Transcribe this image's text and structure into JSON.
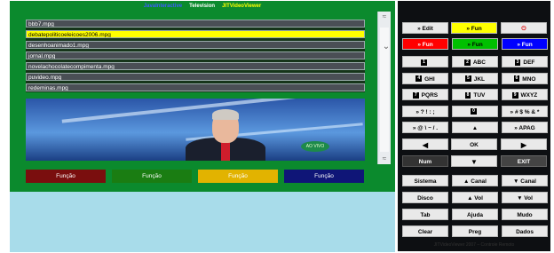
{
  "title_bar": {
    "part1": "JavaInteractive",
    "part2": "Television",
    "part3": "JITVideoViewer",
    "colors": {
      "part1": "#3e5cff",
      "part2": "#ffffff",
      "part3": "#ffff00"
    }
  },
  "playlist": {
    "items": [
      "bbb7.mpg",
      "debatepoliticoeleicoes2006.mpg",
      "desenhoanimado1.mpg",
      "jornal.mpg",
      "novelachocolatecompimenta.mpg",
      "puvideo.mpg",
      "redeminas.mpg"
    ],
    "selected_index": 1
  },
  "video": {
    "overlay_text": "AO VIVO"
  },
  "function_buttons": [
    {
      "label": "Função",
      "color": "#7a0e0e"
    },
    {
      "label": "Função",
      "color": "#1a7d12"
    },
    {
      "label": "Função",
      "color": "#e2b300"
    },
    {
      "label": "Função",
      "color": "#0f1577"
    }
  ],
  "remote": {
    "top": {
      "edit": "» Edit",
      "fun_yellow": "» Fun",
      "power": "⏻"
    },
    "color_keys": [
      {
        "label": "» Fun",
        "color": "#ff0000"
      },
      {
        "label": "» Fun",
        "color": "#00c000"
      },
      {
        "label": "» Fun",
        "color": "#0000ff"
      }
    ],
    "numpad": [
      {
        "num": "1",
        "text": ""
      },
      {
        "num": "2",
        "text": "ABC"
      },
      {
        "num": "3",
        "text": "DEF"
      },
      {
        "num": "4",
        "text": "GHI"
      },
      {
        "num": "5",
        "text": "JKL"
      },
      {
        "num": "6",
        "text": "MNO"
      },
      {
        "num": "7",
        "text": "PQRS"
      },
      {
        "num": "8",
        "text": "TUV"
      },
      {
        "num": "9",
        "text": "WXYZ"
      },
      {
        "num": "",
        "text": "» ? ! : ;"
      },
      {
        "num": "0",
        "text": ""
      },
      {
        "num": "",
        "text": "» # $ % & *"
      },
      {
        "num": "",
        "text": "» @ \\ ~ / ."
      },
      {
        "num": "",
        "text": "▲"
      },
      {
        "num": "",
        "text": "» APAG"
      }
    ],
    "nav": {
      "left": "◀",
      "ok": "OK",
      "right": "▶"
    },
    "row_num": {
      "num": "Num",
      "down": "▼",
      "exit": "EXIT"
    },
    "system_rows": [
      [
        "Sistema",
        "▲ Canal",
        "▼ Canal"
      ],
      [
        "Disco",
        "▲ Vol",
        "▼ Vol"
      ],
      [
        "Tab",
        "Ajuda",
        "Mudo"
      ],
      [
        "Clear",
        "Preg",
        "Dados"
      ]
    ],
    "footer": "JITVideoViewer 2007 – Controle Remoto"
  }
}
